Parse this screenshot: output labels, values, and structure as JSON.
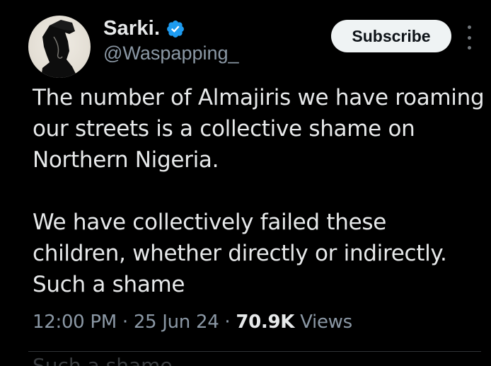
{
  "author": {
    "display_name": "Sarki.",
    "handle": "@Waspapping_",
    "verified": true,
    "verified_color": "#1d9bf0"
  },
  "actions": {
    "subscribe_label": "Subscribe",
    "more_icon": "more-vertical-icon"
  },
  "tweet": {
    "paragraph_1": "The number of Almajiris we have roaming our streets is a collective shame on Northern Nigeria.",
    "paragraph_2": "We have collectively failed these children, whether directly or indirectly. Such a shame"
  },
  "meta": {
    "time": "12:00 PM",
    "separator": "·",
    "date": "25 Jun 24",
    "views_count": "70.9K",
    "views_label": "Views"
  },
  "ghost_text": "Such a shame"
}
